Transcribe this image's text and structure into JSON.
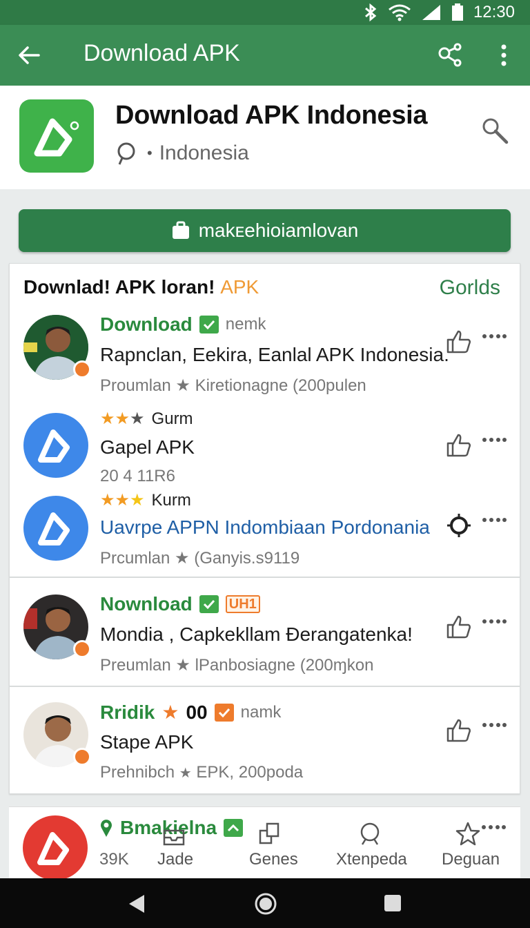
{
  "status_bar": {
    "time": "12:30"
  },
  "app_bar": {
    "title": "Download APK"
  },
  "header": {
    "name": "Download APK Indonesia",
    "location": "Indonesia"
  },
  "primary_button": {
    "label": "makᴇehioiamlovan"
  },
  "section": {
    "title_main": "Downlad! APK loran!",
    "title_accent": "APK",
    "link": "Gorlds"
  },
  "items": [
    {
      "title": "Download",
      "tag": "nemk",
      "text": "Rapnclan, Eekira, Eanlal APK Indonesia.",
      "meta_prefix": "Proumlan",
      "meta": "Kiretionagne (200pulen"
    },
    {
      "title": "Gurm",
      "stars": 2.5,
      "text": "Gapel APK",
      "meta": "20 4 11R6"
    },
    {
      "title": "Kurm",
      "stars": 3,
      "text": "Uavrpe APPN Indombiaan Pordonania",
      "meta_prefix": "Prcumlan",
      "meta": "(Ganyis.s9119"
    },
    {
      "title": "Nownload",
      "tag": "UH1",
      "text": "Mondia , Capkekllam Ɖerangatenka!",
      "meta_prefix": "Preumlan",
      "meta": "lPanbosiagne (200ɱkon"
    },
    {
      "title": "Rridik",
      "score": "00",
      "tag": "namk",
      "text": "Stape APK",
      "meta_prefix": "Prehnibch",
      "meta": "EPK, 200poda"
    },
    {
      "title": "Bmakielna",
      "count": "39K"
    }
  ],
  "tabs": [
    {
      "label": "Jade",
      "icon": "inbox-icon"
    },
    {
      "label": "Genes",
      "icon": "copy-icon"
    },
    {
      "label": "Xtenpeda",
      "icon": "search-icon"
    },
    {
      "label": "Deguan",
      "icon": "star-icon"
    }
  ],
  "colors": {
    "primary": "#3b8d55",
    "dark_primary": "#2e7f4a",
    "accent": "#ee7b2c",
    "link_blue": "#1f5fa6"
  }
}
